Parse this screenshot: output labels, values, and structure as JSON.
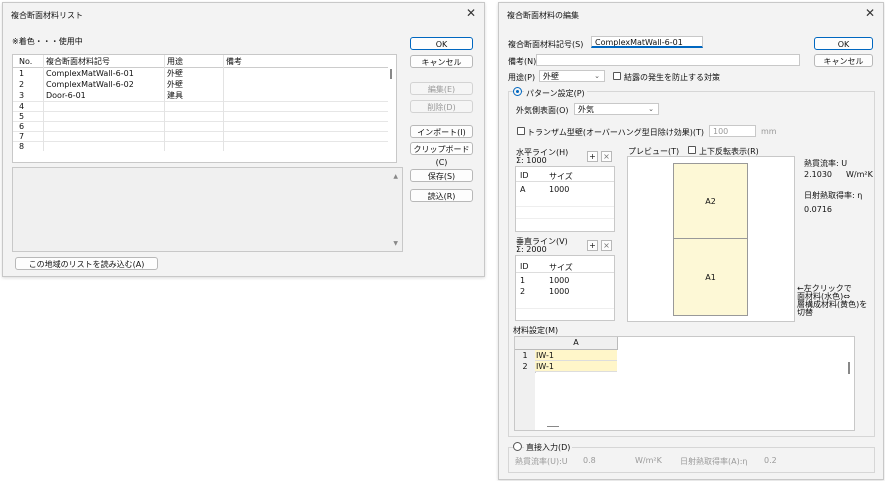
{
  "left_dialog": {
    "title": "複合断面材料リスト",
    "note": "※着色・・・使用中",
    "columns": [
      "No.",
      "複合断面材料記号",
      "用途",
      "備考"
    ],
    "rows": [
      {
        "no": "1",
        "code": "ComplexMatWall-6-01",
        "use": "外壁",
        "note": ""
      },
      {
        "no": "2",
        "code": "ComplexMatWall-6-02",
        "use": "外壁",
        "note": ""
      },
      {
        "no": "3",
        "code": "Door-6-01",
        "use": "建具",
        "note": ""
      },
      {
        "no": "4",
        "code": "",
        "use": "",
        "note": ""
      },
      {
        "no": "5",
        "code": "",
        "use": "",
        "note": ""
      },
      {
        "no": "6",
        "code": "",
        "use": "",
        "note": ""
      },
      {
        "no": "7",
        "code": "",
        "use": "",
        "note": ""
      },
      {
        "no": "8",
        "code": "",
        "use": "",
        "note": ""
      }
    ],
    "buttons": {
      "ok": "OK",
      "cancel": "キャンセル",
      "edit": "編集(E)",
      "delete": "削除(D)",
      "import": "インポート(I)",
      "clipboard": "クリップボード(C)",
      "save": "保存(S)",
      "load": "読込(R)",
      "load_region": "この地域のリストを読み込む(A)"
    }
  },
  "right_dialog": {
    "title": "複合断面材料の編集",
    "code_label": "複合断面材料記号(S)",
    "code_value": "ComplexMatWall-6-01",
    "note_label": "備考(N)",
    "note_value": "",
    "use_label": "用途(P)",
    "use_value": "外壁",
    "condensation_label": "結露の発生を防止する対策",
    "pattern_label": "パターン設定(P)",
    "outer_label": "外気側表面(O)",
    "outer_value": "外気",
    "transom_label": "トランザム型壁(オーバーハング型日除け効果)(T)",
    "transom_value": "100",
    "transom_unit": "mm",
    "horiz_label": "水平ライン(H)",
    "horiz_sum": "Σ: 1000",
    "horiz_cols": [
      "ID",
      "サイズ"
    ],
    "horiz_rows": [
      {
        "id": "A",
        "size": "1000"
      }
    ],
    "vert_label": "垂直ライン(V)",
    "vert_sum": "Σ: 2000",
    "vert_cols": [
      "ID",
      "サイズ"
    ],
    "vert_rows": [
      {
        "id": "1",
        "size": "1000"
      },
      {
        "id": "2",
        "size": "1000"
      }
    ],
    "add": "+",
    "remove": "×",
    "preview_label": "プレビュー(T)",
    "flip_label": "上下反転表示(R)",
    "cells": [
      "A2",
      "A1"
    ],
    "heat_label": "熱貫流率: U",
    "heat_value": "2.1030",
    "heat_unit": "W/m²K",
    "solar_label": "日射熱取得率: η",
    "solar_value": "0.0716",
    "hint": "←左クリックで\n面材料(水色)⇔\n層構成材料(黄色)を\n切替",
    "material_label": "材料設定(M)",
    "material_col": "A",
    "material_rows": [
      {
        "no": "1",
        "val": "IW-1"
      },
      {
        "no": "2",
        "val": "IW-1"
      }
    ],
    "direct_label": "直接入力(D)",
    "direct_u_label": "熱貫流率(U):U",
    "direct_u_value": "0.8",
    "direct_u_unit": "W/m²K",
    "direct_eta_label": "日射熱取得率(A):η",
    "direct_eta_value": "0.2",
    "buttons": {
      "ok": "OK",
      "cancel": "キャンセル"
    }
  },
  "colors": {
    "accent": "#0067c0",
    "cell_fill": "#fdf8d6",
    "material_fill": "#fff6c9"
  }
}
